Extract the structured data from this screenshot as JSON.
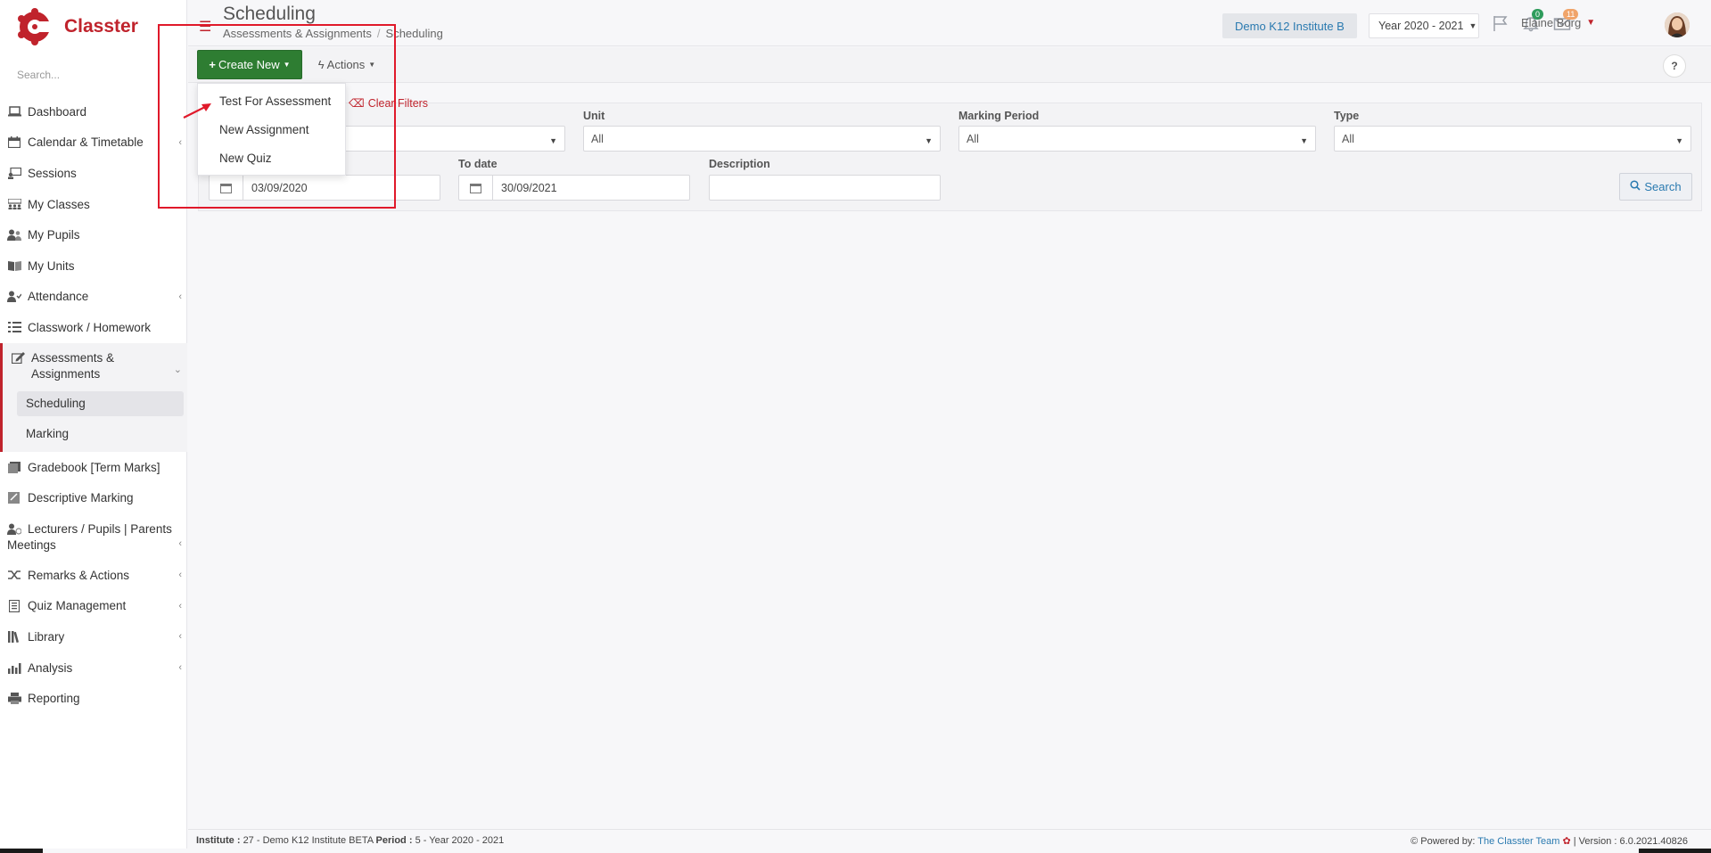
{
  "app": {
    "name": "Classter",
    "brand_color": "#c0232c",
    "accent_color": "#2a7ab0",
    "create_color": "#2e7d32"
  },
  "sidebar": {
    "search_placeholder": "Search...",
    "items": [
      {
        "label": "Dashboard",
        "icon": "laptop-icon",
        "has_children": false
      },
      {
        "label": "Calendar & Timetable",
        "icon": "calendar-icon",
        "has_children": true
      },
      {
        "label": "Sessions",
        "icon": "presentation-icon",
        "has_children": false
      },
      {
        "label": "My Classes",
        "icon": "classes-icon",
        "has_children": false
      },
      {
        "label": "My Pupils",
        "icon": "users-icon",
        "has_children": false
      },
      {
        "label": "My Units",
        "icon": "book-icon",
        "has_children": false
      },
      {
        "label": "Attendance",
        "icon": "attendance-icon",
        "has_children": true
      },
      {
        "label": "Classwork / Homework",
        "icon": "list-icon",
        "has_children": false
      }
    ],
    "active_group": {
      "label": "Assessments & Assignments",
      "icon": "edit-icon",
      "children": [
        "Scheduling",
        "Marking"
      ],
      "active_child": "Scheduling"
    },
    "items_after": [
      {
        "label": "Gradebook [Term Marks]",
        "icon": "gradebook-icon",
        "has_children": false
      },
      {
        "label": "Descriptive Marking",
        "icon": "descriptive-icon",
        "has_children": false
      },
      {
        "label": "Lecturers / Pupils | Parents Meetings",
        "icon": "meeting-icon",
        "has_children": true
      },
      {
        "label": "Remarks & Actions",
        "icon": "shuffle-icon",
        "has_children": true
      },
      {
        "label": "Quiz Management",
        "icon": "quiz-icon",
        "has_children": true
      },
      {
        "label": "Library",
        "icon": "library-icon",
        "has_children": true
      },
      {
        "label": "Analysis",
        "icon": "chart-icon",
        "has_children": true
      },
      {
        "label": "Reporting",
        "icon": "printer-icon",
        "has_children": false
      }
    ]
  },
  "header": {
    "title": "Scheduling",
    "breadcrumb": [
      "Assessments & Assignments",
      "Scheduling"
    ],
    "institute": "Demo K12 Institute B",
    "year": "Year 2020 - 2021",
    "notifications_count": "0",
    "messages_count": "11",
    "user_name": "Elaine Borg"
  },
  "toolbar": {
    "create_label": "Create New",
    "actions_label": "Actions",
    "help_label": "?"
  },
  "create_menu": {
    "items": [
      "Test For Assessment",
      "New Assignment",
      "New Quiz"
    ]
  },
  "filters": {
    "clear_label": "Clear Filters",
    "unit_label": "Unit",
    "unit_value": "All",
    "marking_period_label": "Marking Period",
    "marking_period_value": "All",
    "type_label": "Type",
    "type_value": "All",
    "from_date_value": "03/09/2020",
    "to_date_label": "To date",
    "to_date_value": "30/09/2021",
    "description_label": "Description",
    "description_value": "",
    "search_label": "Search"
  },
  "footer": {
    "institute_label": "Institute :",
    "institute_value": "27 - Demo K12 Institute BETA",
    "period_label": "Period :",
    "period_value": "5 - Year 2020 - 2021",
    "powered_by": "Powered by:",
    "team": "The Classter Team",
    "version": "| Version : 6.0.2021.40826"
  }
}
